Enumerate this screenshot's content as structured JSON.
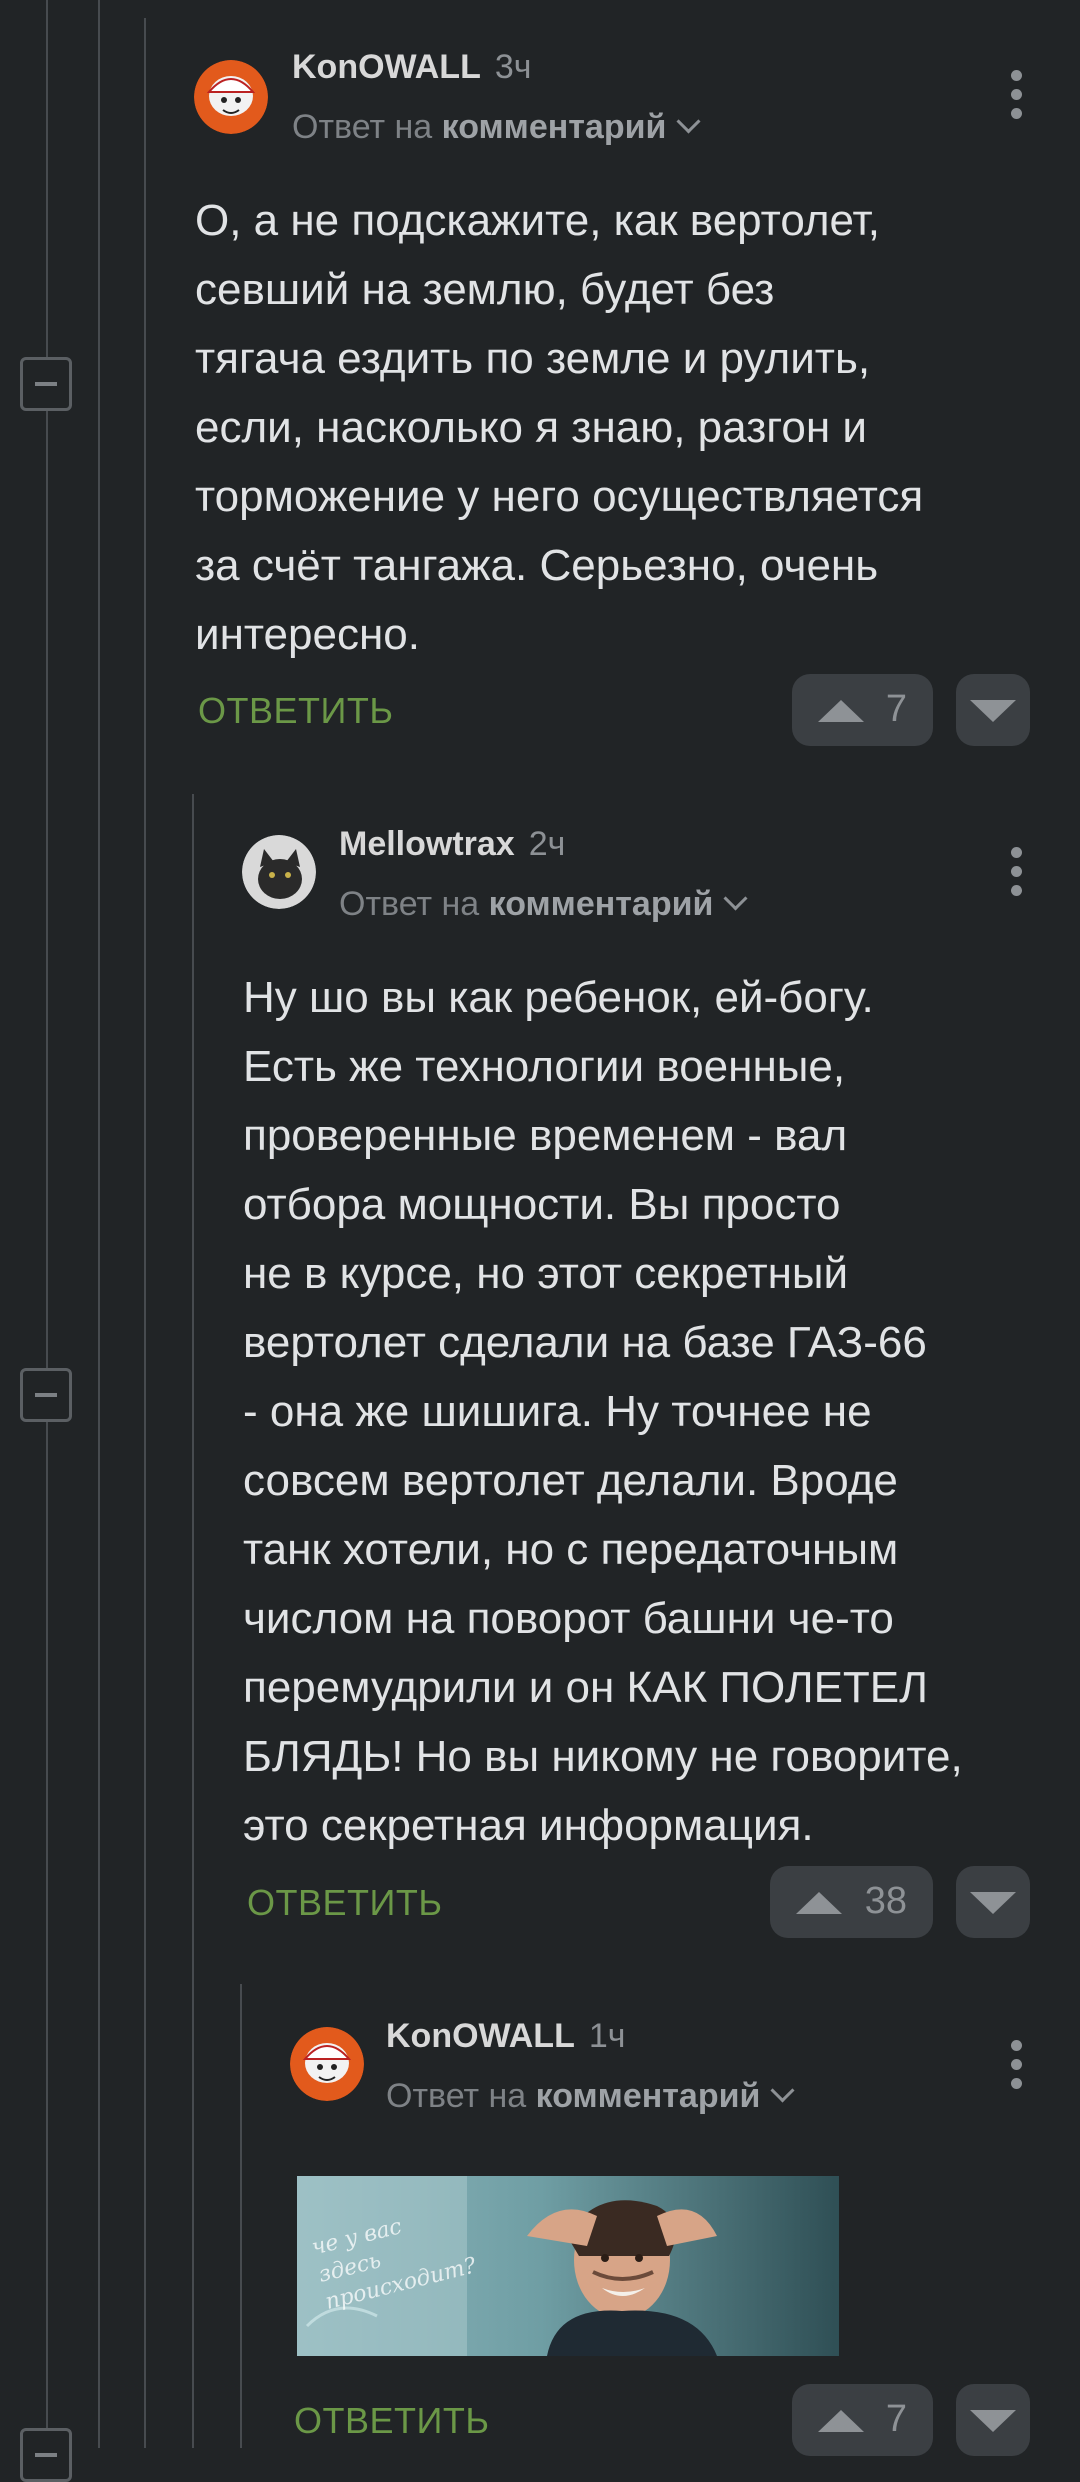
{
  "comments": [
    {
      "author": "KonOWALL",
      "time": "3ч",
      "reply_prefix": "Ответ на",
      "reply_target": "комментарий",
      "text": "О, а не подскажите, как вертолет,\nсевший на землю, будет без\nтягача ездить по земле и рулить,\nесли, насколько я знаю, разгон и\nторможение у него осуществляется\nза счёт тангажа. Серьезно, очень\nинтересно.",
      "reply_label": "ОТВЕТИТЬ",
      "rating": "7"
    },
    {
      "author": "Mellowtrax",
      "time": "2ч",
      "reply_prefix": "Ответ на",
      "reply_target": "комментарий",
      "text": "Ну шо вы как ребенок, ей-богу.\nЕсть же технологии военные,\nпроверенные временем - вал\nотбора мощности. Вы просто\nне в курсе, но этот секретный\nвертолет сделали на базе ГАЗ-66\n- она же шишига. Ну точнее не\nсовсем вертолет делали. Вроде\nтанк хотели, но с передаточным\nчислом на поворот башни че-то\nперемудрили и он КАК ПОЛЕТЕЛ\nБЛЯДЬ! Но вы никому не говорите,\nэто секретная информация.",
      "reply_label": "ОТВЕТИТЬ",
      "rating": "38"
    },
    {
      "author": "KonOWALL",
      "time": "1ч",
      "reply_prefix": "Ответ на",
      "reply_target": "комментарий",
      "image_caption": "че у вас здесь происходит?",
      "reply_label": "ОТВЕТИТЬ",
      "rating": "7"
    }
  ],
  "colors": {
    "background": "#212426",
    "reply_green": "#6b9847",
    "vote_bg": "#3b3f43"
  },
  "icons": {
    "collapse": "minus-square-icon",
    "more": "vertical-dots-icon",
    "upvote": "triangle-up-icon",
    "downvote": "triangle-down-icon",
    "chevron": "chevron-down-icon"
  }
}
